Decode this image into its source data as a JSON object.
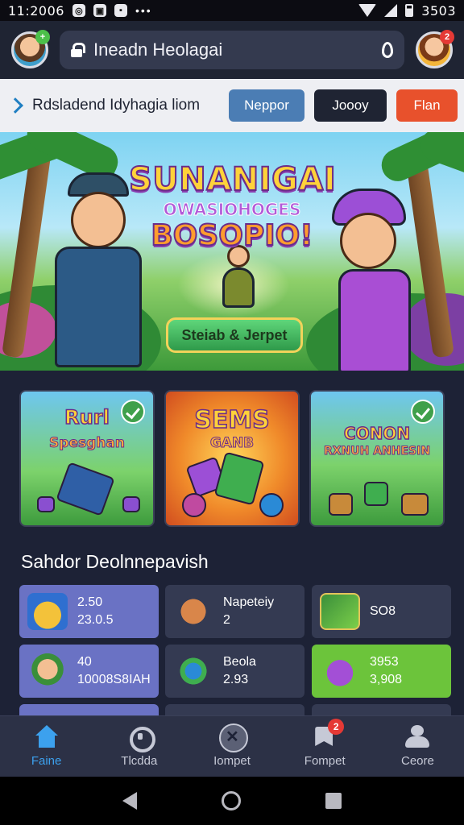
{
  "status_bar": {
    "time": "11:2006",
    "right_time": "3503"
  },
  "header": {
    "search_text": "Ineadn Heolagai",
    "profile_badge": "2"
  },
  "subbar": {
    "title": "Rdsladend Idyhagia liom",
    "buttons": [
      "Neppor",
      "Joooy",
      "Flan"
    ]
  },
  "hero": {
    "title_line1": "SUNANIGAI",
    "title_line2": "OWASIOHOGES",
    "title_line3": "BOSOPIO!",
    "cta_label": "Steiab & Jerpet"
  },
  "featured_games": [
    {
      "title": "Rurl",
      "subtitle": "Spesghan"
    },
    {
      "title": "SEMS",
      "subtitle": "GANB"
    },
    {
      "title": "CONON",
      "subtitle": "RXNUH\nANHESIN"
    }
  ],
  "section_title": "Sahdor Deolnnepavish",
  "tiles": [
    {
      "line1": "2.50",
      "line2": "23.0.5",
      "style": "purple"
    },
    {
      "line1": "Napeteiy",
      "line2": "2",
      "style": "dark"
    },
    {
      "line1": "SO8",
      "line2": "",
      "style": "dark"
    },
    {
      "line1": "40",
      "line2": "10008S8IAH",
      "style": "purple"
    },
    {
      "line1": "Beola",
      "line2": "2.93",
      "style": "dark"
    },
    {
      "line1": "3953",
      "line2": "3,908",
      "style": "green"
    }
  ],
  "bottom_nav": [
    {
      "label": "Faine",
      "icon": "home-icon",
      "active": true
    },
    {
      "label": "Tlcdda",
      "icon": "games-icon",
      "active": false
    },
    {
      "label": "Iompet",
      "icon": "compete-icon",
      "active": false
    },
    {
      "label": "Fompet",
      "icon": "flag-icon",
      "active": false,
      "badge": "2"
    },
    {
      "label": "Ceore",
      "icon": "profile-icon",
      "active": false
    }
  ],
  "colors": {
    "background": "#1d2236",
    "accent": "#3ca1ee",
    "tile_purple": "#6a72c4",
    "tile_green": "#6cc43b",
    "danger": "#e53935"
  }
}
